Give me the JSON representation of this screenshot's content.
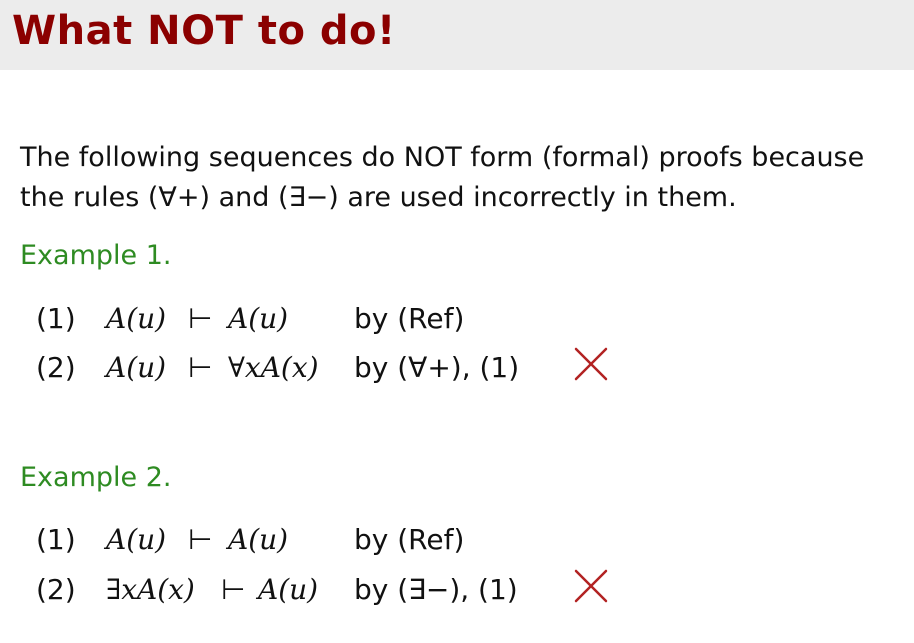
{
  "slide": {
    "title": "What NOT to do!",
    "intro": "The following sequences do NOT form (formal) proofs because the rules (∀+) and (∃−) are used incorrectly in them.",
    "accent_color": "#8b0000",
    "example_color": "#2e8b22"
  },
  "examples": [
    {
      "label": "Example 1.",
      "steps": [
        {
          "num": "(1)",
          "lhs": "A(u)",
          "turnstile": "⊢",
          "rhs": "A(u)",
          "rule": "by (Ref)"
        },
        {
          "num": "(2)",
          "lhs": "A(u)",
          "turnstile": "⊢",
          "rhs": "∀xA(x)",
          "rule": "by (∀+), (1)",
          "marked_wrong": true
        }
      ]
    },
    {
      "label": "Example 2.",
      "steps": [
        {
          "num": "(1)",
          "lhs": "A(u)",
          "turnstile": "⊢",
          "rhs": "A(u)",
          "rule": "by (Ref)"
        },
        {
          "num": "(2)",
          "lhs": "∃xA(x)",
          "turnstile": "⊢",
          "rhs": "A(u)",
          "rule": "by (∃−), (1)",
          "marked_wrong": true
        }
      ]
    }
  ],
  "icons": {
    "wrong_mark": "cross-icon",
    "wrong_mark_color": "#b22222"
  }
}
